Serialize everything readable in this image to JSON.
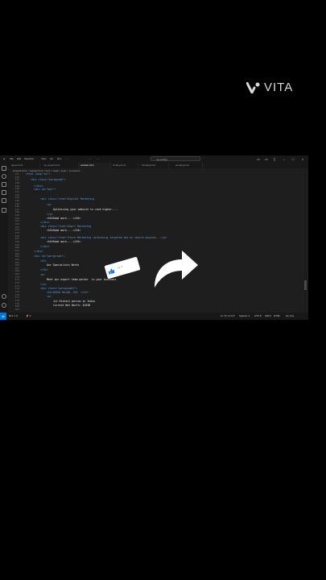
{
  "watermark": {
    "brand": "VITA"
  },
  "window": {
    "menu": [
      "File",
      "Edit",
      "Selection",
      "View",
      "Go",
      "Run",
      "…"
    ],
    "search_placeholder": "my-coding"
  },
  "tabs": [
    {
      "label": "figure.html",
      "active": false
    },
    {
      "label": "my project.html",
      "active": false
    },
    {
      "label": "website.html",
      "active": true
    },
    {
      "label": "Coding.html",
      "active": false
    },
    {
      "label": "Scoding.html",
      "active": false
    },
    {
      "label": "acoding.html",
      "active": false
    }
  ],
  "breadcrumb": "project1.html  >  website.html  >  html  >  head  >  style  >  .tp-column",
  "line_numbers": [
    "135",
    "136",
    "137",
    "138",
    "139",
    "140",
    "141",
    "142",
    "143",
    "144",
    "145",
    "146",
    "147",
    "148",
    "149",
    "150",
    "151",
    "152",
    "153",
    "154",
    "155",
    "156",
    "157",
    "158",
    "159",
    "160",
    "161",
    "162",
    "163",
    "164",
    "165",
    "166",
    "167",
    "168",
    "169",
    "170",
    "171",
    "172",
    "173",
    "174",
    "175",
    "176",
    "177",
    "178",
    "179",
    "180",
    "181"
  ],
  "code": {
    "l1": "<html lang=\"en\">",
    "l2": "<div class=\"paragraph\">",
    "l3": "</div>",
    "l4": "<div id=\"box\">",
    "l5": "<div class=\"item\">Digital Marketing",
    "l6": "<p>",
    "l7": "Optimizing your website to rank higher....",
    "l8": "</p>",
    "l9": "<h5>Read more....</h5>",
    "l10": "</div>",
    "l11": "<div class=\"item\">Email Marketing",
    "l12": "<h5>Read more....</h5>",
    "l13": "<div class=\"item\">Store Marketing <p>Running targeted ads on search engines...</p>",
    "l14": "<h5>Read more....</h5>",
    "l15": "</div>",
    "l16": "</div>",
    "l17": "<div id=\"paragraph\">",
    "l18": "<h2>",
    "l19": "Our Specialists Works",
    "l20": "</h2>",
    "l21": "<p>",
    "l22": "Meet our expert team worker  in your business",
    "l23": "</p>",
    "l24": "<div class=\"paragraph2\">",
    "l25": "<h2>ADIOR NAJON, CEO  </h2>",
    "l26": "<p>",
    "l27": "1st Richest person in India",
    "l28": "Current Net Worth: $195B"
  },
  "status": {
    "errors": "⊗ 0  ⚠ 0",
    "warnings": "⚡ 0",
    "position": "Ln 72, Col 27",
    "spaces": "Spaces: 4",
    "encoding": "UTF-8",
    "eol": "CRLF",
    "language": "HTML",
    "live": "Go Live"
  },
  "overlay": {
    "like_text": "+1 ↗"
  }
}
